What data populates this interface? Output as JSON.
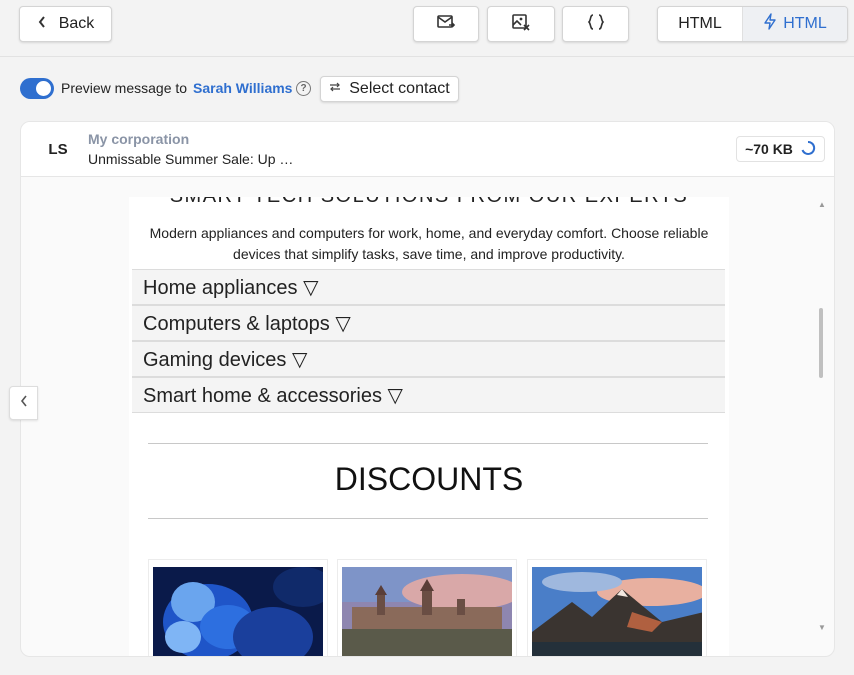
{
  "toolbar": {
    "back_label": "Back",
    "html_label": "HTML",
    "amp_html_label": "HTML"
  },
  "preview": {
    "label": "Preview message to",
    "contact_name": "Sarah Williams",
    "help": "?",
    "select_contact_label": "Select contact"
  },
  "message": {
    "avatar_initials": "LS",
    "sender": "My corporation",
    "subject": "Unmissable Summer Sale: Up …",
    "size": "~70 KB"
  },
  "email": {
    "clipped_heading": "SMART TECH SOLUTIONS FROM OUR EXPERTS",
    "description": "Modern appliances and computers for work, home, and everyday comfort. Choose reliable devices that simplify tasks, save time, and improve productivity.",
    "accordion": [
      {
        "label": "Home appliances ▽"
      },
      {
        "label": "Computers & laptops ▽"
      },
      {
        "label": "Gaming devices ▽"
      },
      {
        "label": "Smart home & accessories ▽"
      }
    ],
    "discounts_heading": "DISCOUNTS",
    "products": [
      {
        "image": "blue-flower-image"
      },
      {
        "image": "castle-landscape-image"
      },
      {
        "image": "mountain-landscape-image"
      }
    ]
  },
  "colors": {
    "accent": "#2f6fcf",
    "sender_gray": "#8a94a6"
  }
}
